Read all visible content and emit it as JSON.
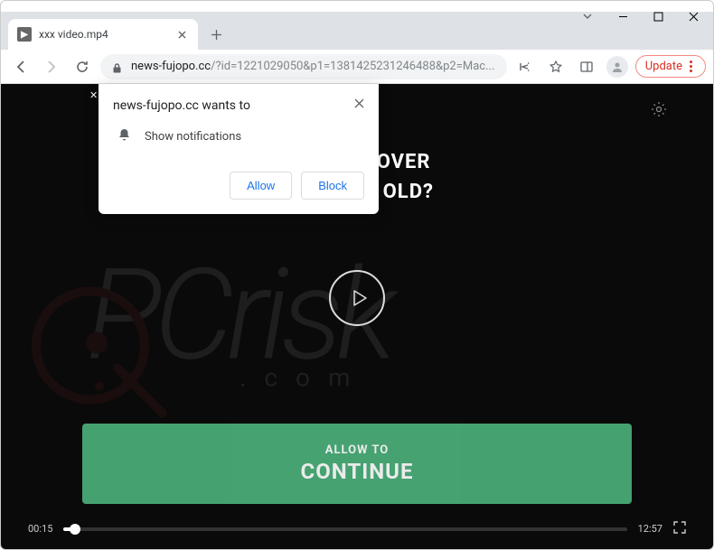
{
  "window": {
    "tab_title": "xxx video.mp4"
  },
  "toolbar": {
    "url_domain": "news-fujopo.cc",
    "url_path": "/?id=1221029050&p1=1381425231246488&p2=Mac...",
    "update_label": "Update"
  },
  "permission": {
    "title": "news-fujopo.cc wants to",
    "request": "Show notifications",
    "allow_label": "Allow",
    "block_label": "Block"
  },
  "page": {
    "age_line1": "OVER",
    "age_line2": "OLD?",
    "cta_line1": "ALLOW TO",
    "cta_line2": "CONTINUE"
  },
  "video": {
    "current_time": "00:15",
    "duration": "12:57"
  },
  "watermark": {
    "main": "PCrisk",
    "sub": ".com"
  }
}
